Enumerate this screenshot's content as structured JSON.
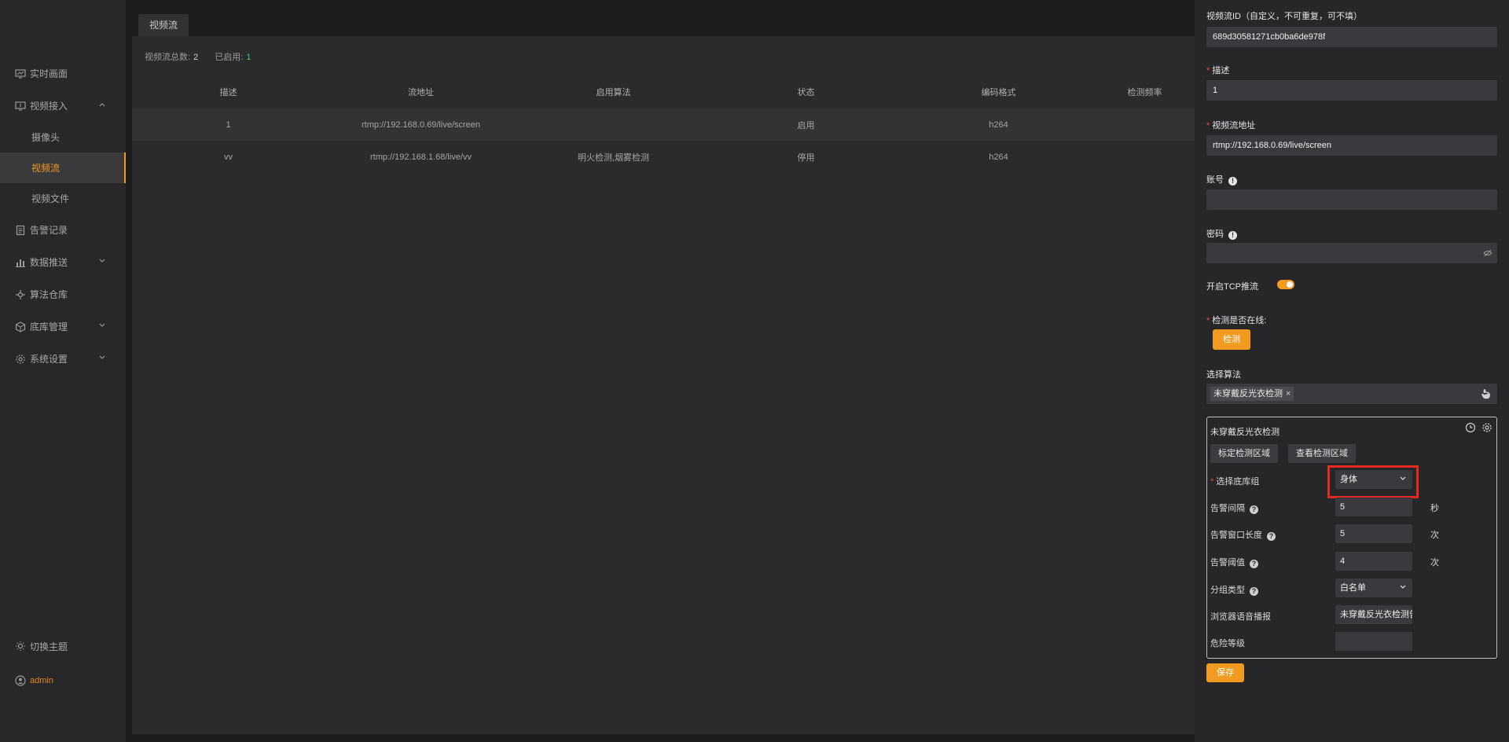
{
  "sidebar": {
    "items": [
      {
        "label": "实时画面",
        "icon": "monitor-icon"
      },
      {
        "label": "视频接入",
        "icon": "video-input-icon",
        "expanded": true
      },
      {
        "label": "摄像头",
        "sub": true
      },
      {
        "label": "视频流",
        "sub": true,
        "active": true
      },
      {
        "label": "视频文件",
        "sub": true
      },
      {
        "label": "告警记录",
        "icon": "document-icon"
      },
      {
        "label": "数据推送",
        "icon": "chart-icon",
        "expanded": false
      },
      {
        "label": "算法仓库",
        "icon": "algorithm-icon"
      },
      {
        "label": "底库管理",
        "icon": "cube-icon",
        "expanded": false
      },
      {
        "label": "系统设置",
        "icon": "gear-icon",
        "expanded": false
      }
    ],
    "theme_label": "切换主题",
    "user_label": "admin"
  },
  "main": {
    "tab_label": "视频流",
    "stats": {
      "total_label": "视频流总数:",
      "total": "2",
      "enabled_label": "已启用:",
      "enabled": "1"
    },
    "columns": [
      "描述",
      "流地址",
      "启用算法",
      "状态",
      "编码格式",
      "检测频率"
    ],
    "rows": [
      [
        "1",
        "rtmp://192.168.0.69/live/screen",
        "",
        "启用",
        "h264",
        ""
      ],
      [
        "vv",
        "rtmp://192.168.1.68/live/vv",
        "明火检测,烟雾检测",
        "停用",
        "h264",
        ""
      ]
    ]
  },
  "drawer": {
    "stream_id_label": "视频流ID（自定义，不可重复，可不填）",
    "stream_id_value": "689d30581271cb0ba6de978f",
    "desc_label": "描述",
    "desc_value": "1",
    "url_label": "视频流地址",
    "url_value": "rtmp://192.168.0.69/live/screen",
    "account_label": "账号",
    "password_label": "密码",
    "tcp_label": "开启TCP推流",
    "tcp_enabled": true,
    "online_label": "检测是否在线:",
    "detect_button": "检测",
    "algo_label": "选择算法",
    "algo_tag": "未穿戴反光衣检测",
    "algo_box": {
      "title": "未穿戴反光衣检测",
      "calibrate_button": "标定检测区域",
      "view_button": "查看检测区域",
      "group_label": "选择底库组",
      "group_value": "身体",
      "interval_label": "告警间隔",
      "interval_value": "5",
      "interval_unit": "秒",
      "window_label": "告警窗口长度",
      "window_value": "5",
      "window_unit": "次",
      "threshold_label": "告警阈值",
      "threshold_value": "4",
      "threshold_unit": "次",
      "group_type_label": "分组类型",
      "group_type_value": "白名单",
      "voice_label": "浏览器语音播报",
      "voice_value": "未穿戴反光衣检测告警",
      "risk_label": "危险等级",
      "risk_value": ""
    },
    "save_button": "保存"
  },
  "colors": {
    "accent": "#f39a20",
    "highlight_box": "#e22a22",
    "enabled_green": "#3cc36c"
  }
}
